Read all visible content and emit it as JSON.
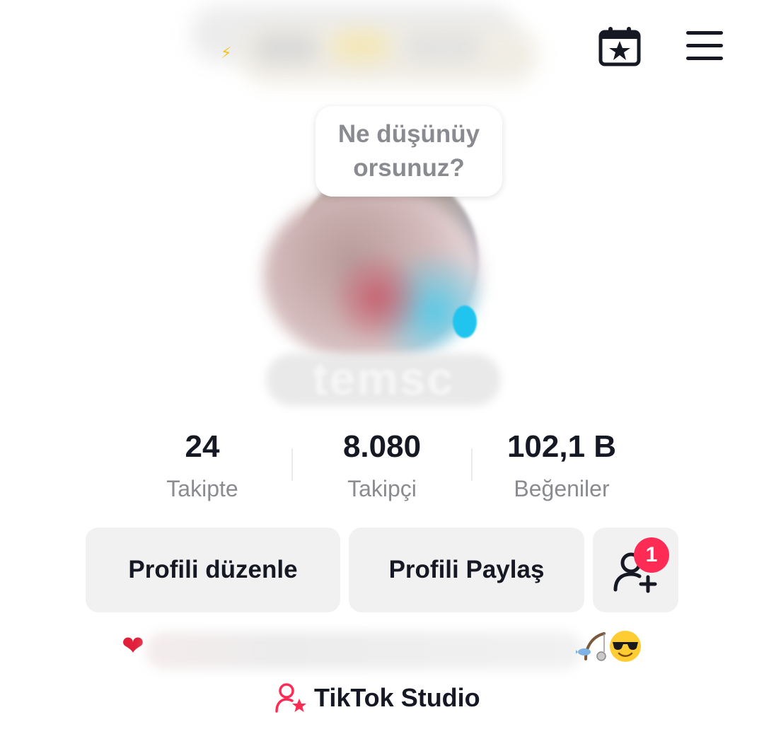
{
  "profile": {
    "bubble_text": "Ne düşünüyorsunuz?",
    "name_partial": "temsc"
  },
  "stats": {
    "following": {
      "value": "24",
      "label": "Takipte"
    },
    "followers": {
      "value": "8.080",
      "label": "Takipçi"
    },
    "likes": {
      "value": "102,1 B",
      "label": "Beğeniler"
    }
  },
  "actions": {
    "edit_label": "Profili düzenle",
    "share_label": "Profili Paylaş",
    "add_friends_badge": "1"
  },
  "bio": {
    "leading_emoji": "❤",
    "trailing_emojis": [
      "fishing-pole-icon",
      "sunglasses-face-icon"
    ]
  },
  "studio": {
    "label": "TikTok Studio"
  },
  "icons": {
    "header": [
      "calendar-star-icon",
      "menu-icon"
    ],
    "add_friends": "add-user-icon",
    "studio": "creator-star-icon"
  },
  "colors": {
    "accent": "#fe2c55",
    "text_primary": "#161823",
    "text_secondary": "#8a8b91",
    "button_bg": "#f1f1f2"
  }
}
